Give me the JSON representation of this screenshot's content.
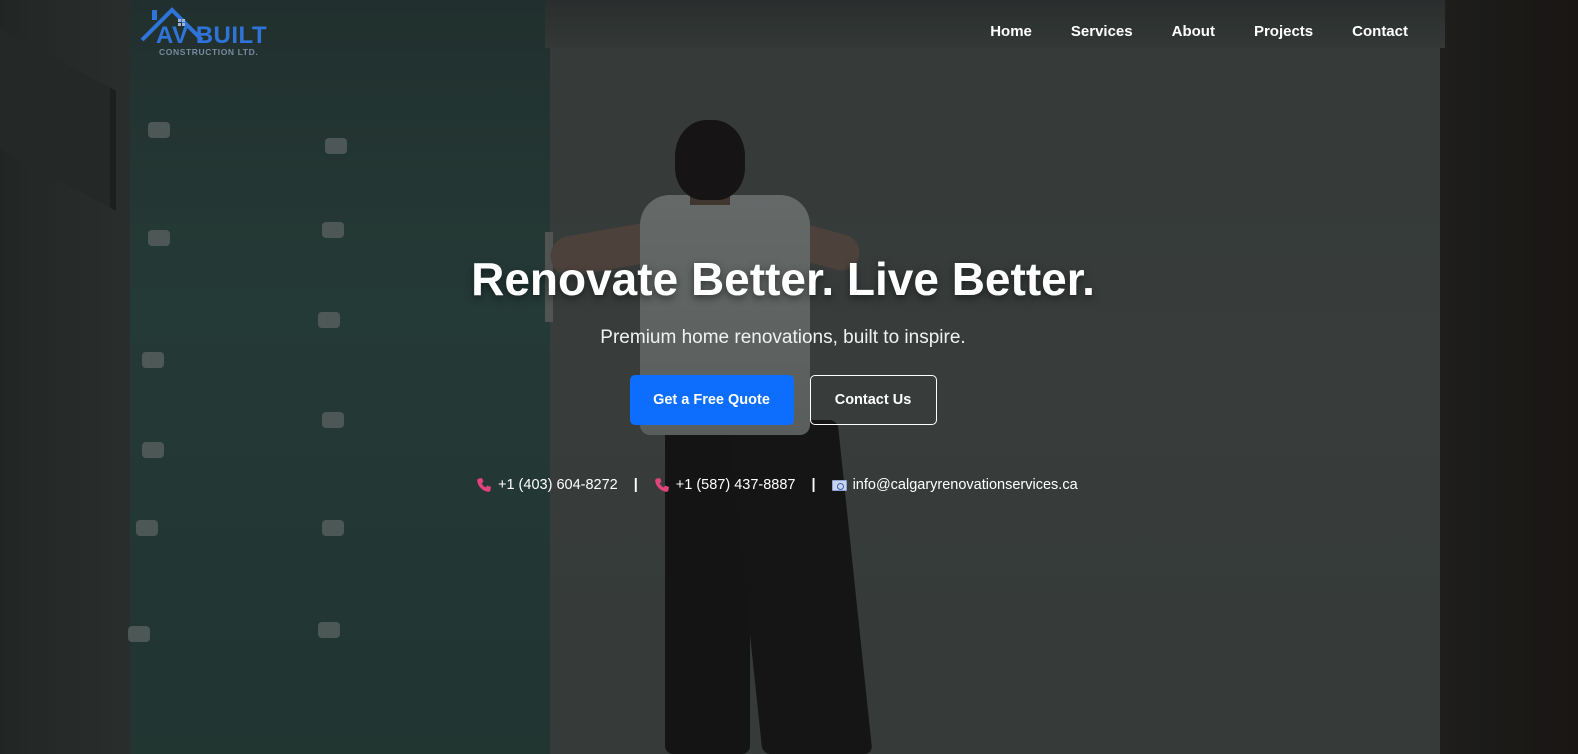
{
  "brand": {
    "name": "AV BUILT",
    "tagline": "CONSTRUCTION LTD.",
    "color": "#2f74d9"
  },
  "nav": {
    "items": [
      {
        "label": "Home"
      },
      {
        "label": "Services"
      },
      {
        "label": "About"
      },
      {
        "label": "Projects"
      },
      {
        "label": "Contact"
      }
    ]
  },
  "hero": {
    "headline": "Renovate Better. Live Better.",
    "subheadline": "Premium home renovations, built to inspire.",
    "primary_button": "Get a Free Quote",
    "secondary_button": "Contact Us",
    "primary_color": "#0d6efd"
  },
  "contacts": {
    "phone_1": "+1 (403) 604-8272",
    "phone_2": "+1 (587) 437-8887",
    "email": "info@calgaryrenovationservices.ca",
    "separator": "|",
    "icons": {
      "phone": "phone-icon",
      "email": "email-icon"
    },
    "phone_icon_color": "#e0447a"
  }
}
